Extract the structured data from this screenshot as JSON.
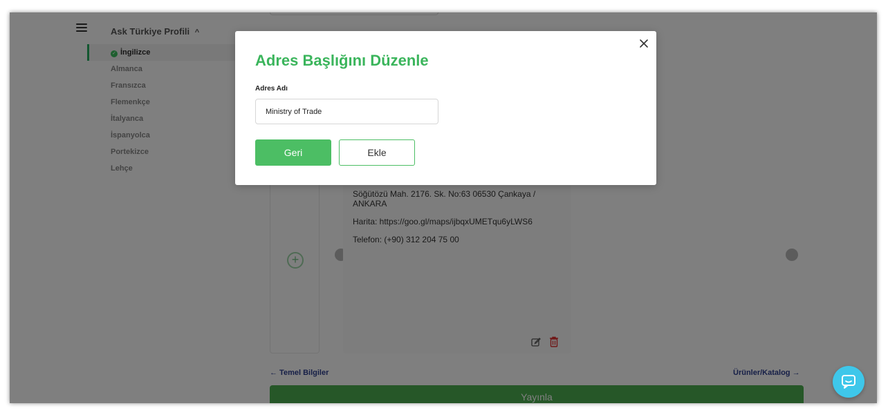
{
  "sidebar": {
    "profile_title": "Ask Türkiye Profili",
    "profile_chevron": "^",
    "languages": [
      {
        "label": "İngilizce"
      },
      {
        "label": "Almanca"
      },
      {
        "label": "Fransızca"
      },
      {
        "label": "Flemenkçe"
      },
      {
        "label": "İtalyanca"
      },
      {
        "label": "İspanyolca"
      },
      {
        "label": "Portekizce"
      },
      {
        "label": "Lehçe"
      }
    ]
  },
  "address_card": {
    "address": "Söğütözü Mah. 2176. Sk. No:63 06530 Çankaya / ANKARA",
    "map": "Harita: https://goo.gl/maps/ijbqxUMETqu6yLWS6",
    "phone": "Telefon: (+90) 312 204 75 00",
    "add_symbol": "+"
  },
  "navigation": {
    "prev_label": "← Temel Bilgiler",
    "next_label": "Ürünler/Katalog →"
  },
  "publish_label": "Yayınla",
  "modal": {
    "title": "Adres Başlığını Düzenle",
    "field_label": "Adres Adı",
    "field_value": "Ministry of Trade",
    "back_label": "Geri",
    "add_label": "Ekle"
  },
  "colors": {
    "accent_green": "#3bb55c",
    "chat_blue": "#3ec7ea",
    "link_blue": "#2c3e8f"
  }
}
